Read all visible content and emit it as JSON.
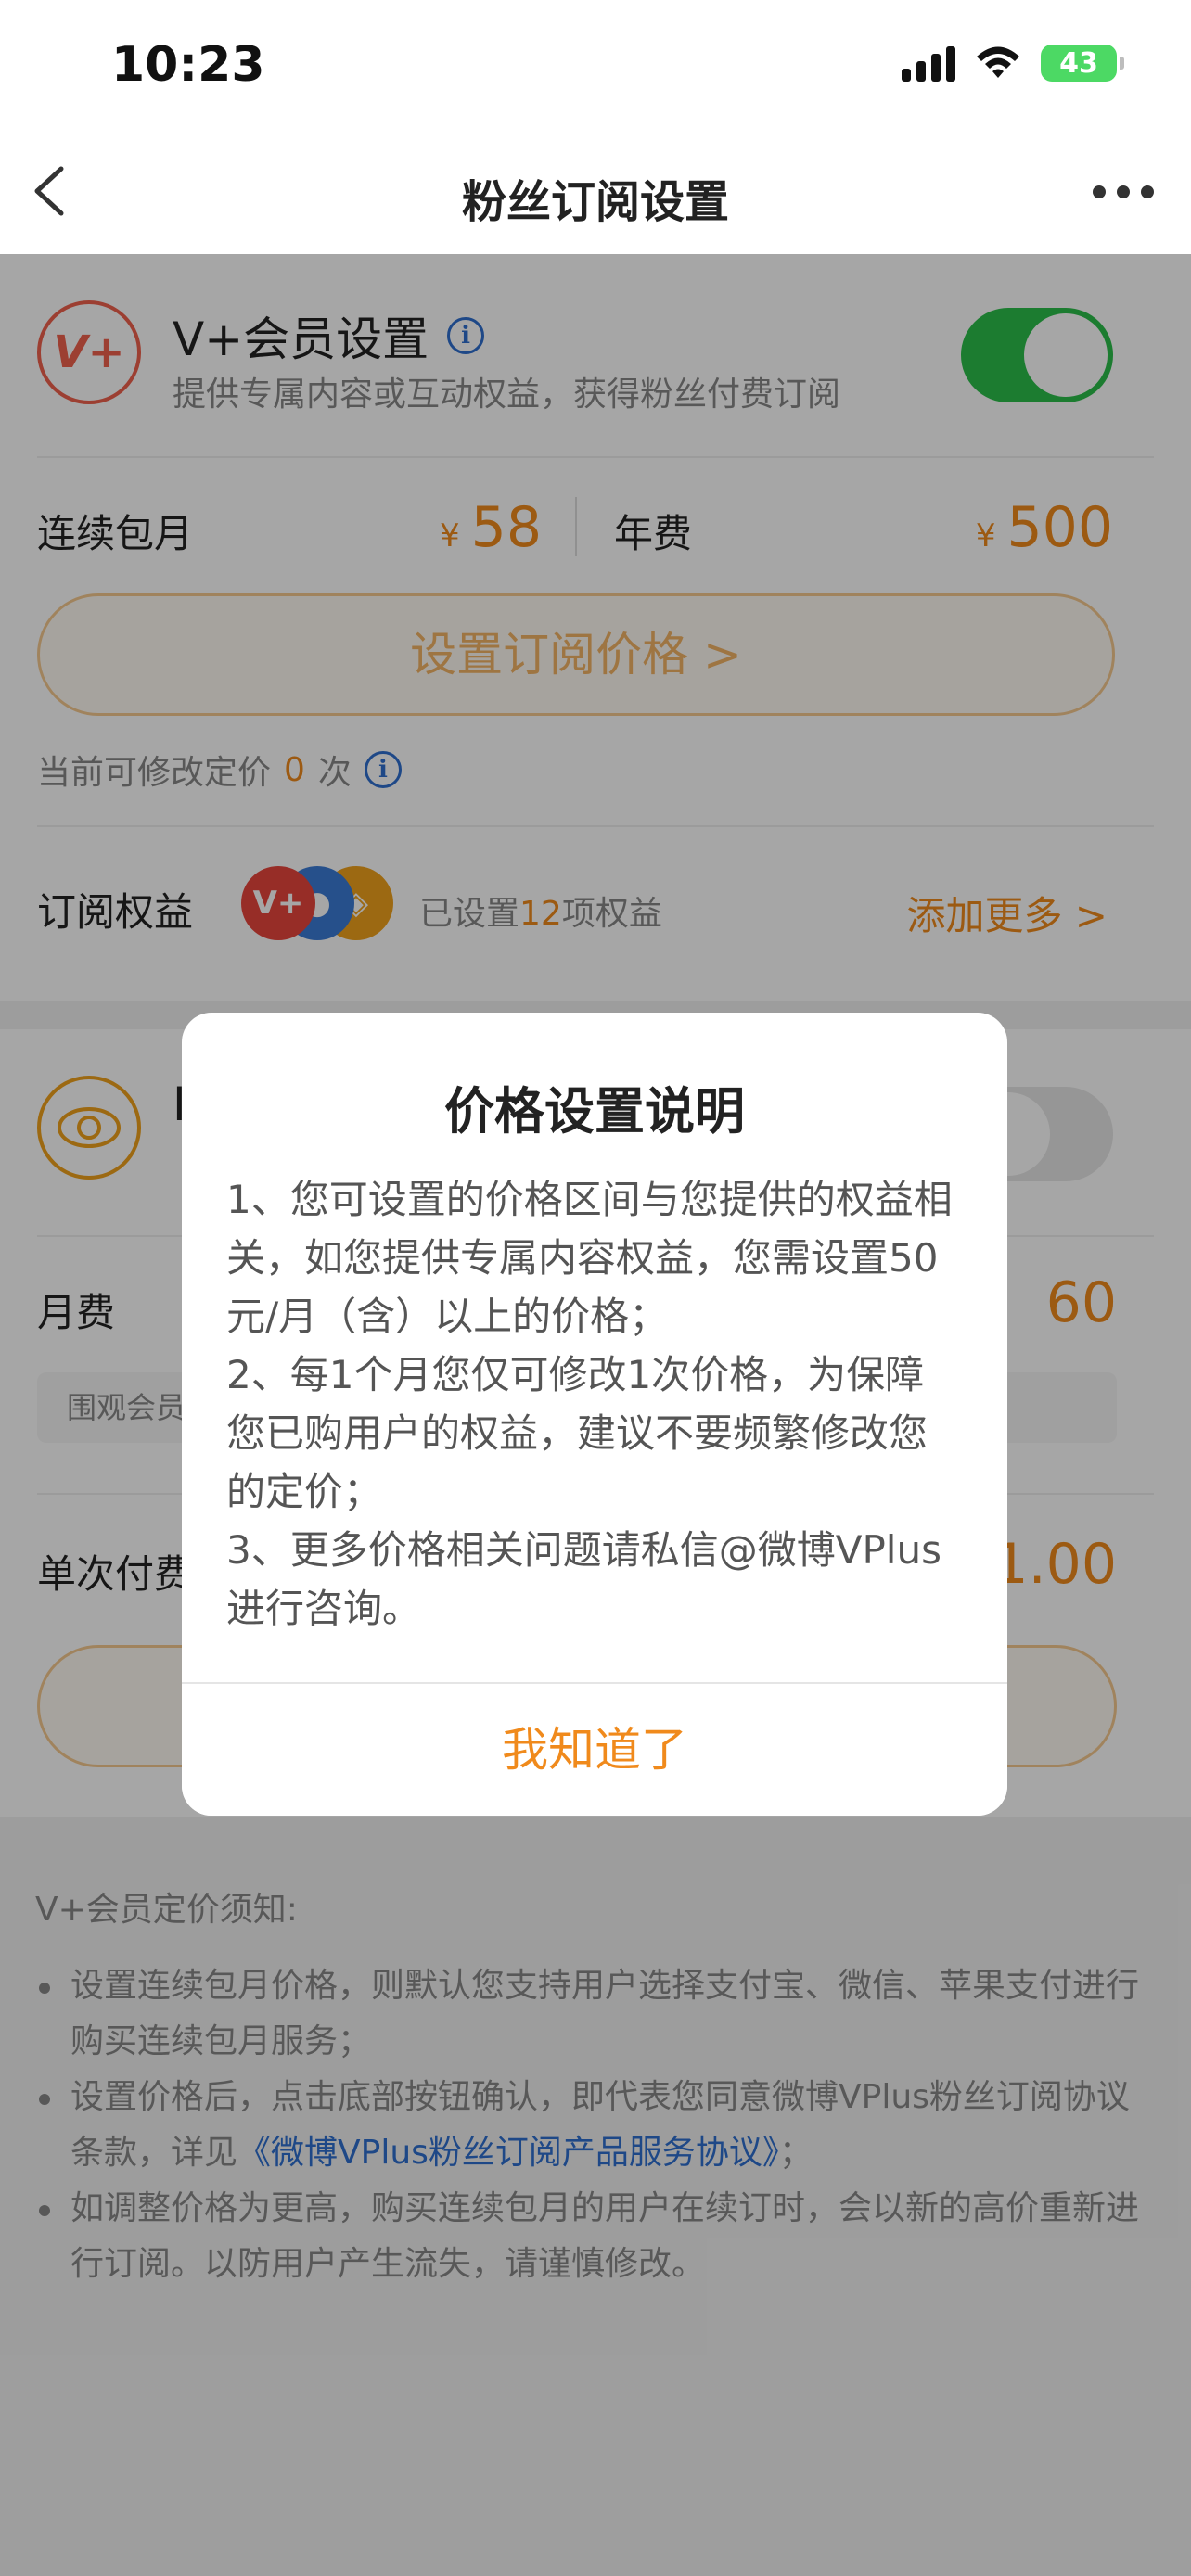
{
  "status_bar": {
    "time": "10:23",
    "battery": "43"
  },
  "nav": {
    "title": "粉丝订阅设置"
  },
  "vip": {
    "logo": "V+",
    "title": "V+会员设置",
    "desc": "提供专属内容或互动权益，获得粉丝付费订阅",
    "toggle_on": true
  },
  "price": {
    "monthly_label": "连续包月",
    "monthly_currency": "¥",
    "monthly_value": "58",
    "yearly_label": "年费",
    "yearly_currency": "¥",
    "yearly_value": "500",
    "set_button": "设置订阅价格 >",
    "modify_prefix": "当前可修改定价",
    "modify_count": "0",
    "modify_suffix": "次"
  },
  "benefits": {
    "label": "订阅权益",
    "text_prefix": "已设置",
    "count": "12",
    "text_suffix": "项权益",
    "add_more": "添加更多 >"
  },
  "card2": {
    "title_partial": "I",
    "monthly_label": "月费",
    "monthly_value_partial": "60",
    "chip_partial": "围观会员",
    "single_label_partial": "单次付费",
    "single_value_partial": "1.00"
  },
  "notes": {
    "title": "V+会员定价须知:",
    "items": [
      "设置连续包月价格，则默认您支持用户选择支付宝、微信、苹果支付进行购买连续包月服务；",
      "设置价格后，点击底部按钮确认，即代表您同意微博VPlus粉丝订阅协议条款，详见",
      "如调整价格为更高，购买连续包月的用户在续订时，会以新的高价重新进行订阅。以防用户产生流失，请谨慎修改。"
    ],
    "link_text": "《微博VPlus粉丝订阅产品服务协议》",
    "link_suffix": "；"
  },
  "dialog": {
    "title": "价格设置说明",
    "lines": [
      "1、您可设置的价格区间与您提供的权益相关，如您提供专属内容权益，您需设置50元/月（含）以上的价格；",
      "2、每1个月您仅可修改1次价格，为保障您已购用户的权益，建议不要频繁修改您的定价；",
      "3、更多价格相关问题请私信@微博VPlus进行咨询。"
    ],
    "confirm": "我知道了"
  },
  "colors": {
    "accent": "#f08a1c",
    "toggle_on": "#2bbf4a",
    "link": "#2f6fcf",
    "vip_red": "#f0624d"
  }
}
